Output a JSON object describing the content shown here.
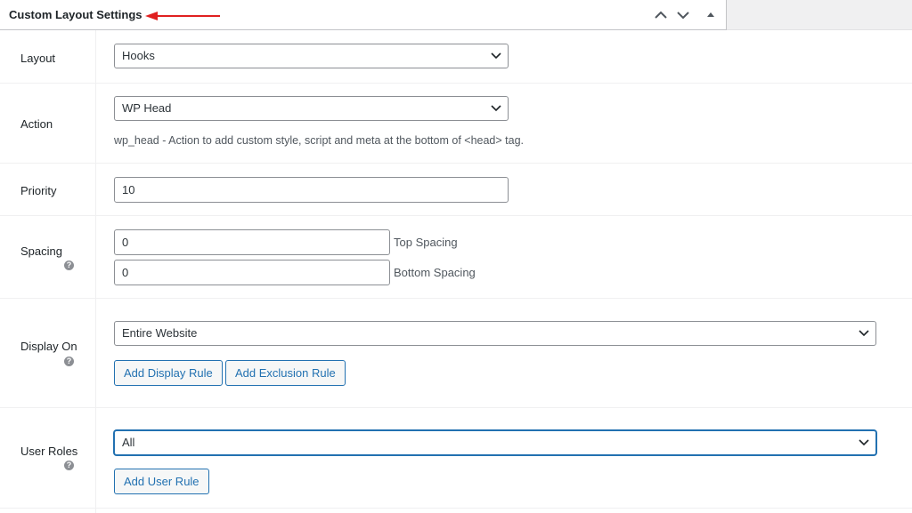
{
  "panel": {
    "title": "Custom Layout Settings",
    "controls": [
      "chevron-up-icon",
      "chevron-down-icon",
      "triangle-up-icon"
    ],
    "arrow_color": "#e02020"
  },
  "fields": {
    "layout": {
      "label": "Layout",
      "value": "Hooks"
    },
    "action": {
      "label": "Action",
      "value": "WP Head",
      "description": "wp_head - Action to add custom style, script and meta at the bottom of <head> tag."
    },
    "priority": {
      "label": "Priority",
      "value": "10"
    },
    "spacing": {
      "label": "Spacing",
      "top_value": "0",
      "top_label": "Top Spacing",
      "bottom_value": "0",
      "bottom_label": "Bottom Spacing"
    },
    "display_on": {
      "label": "Display On",
      "value": "Entire Website",
      "add_display_rule": "Add Display Rule",
      "add_exclusion_rule": "Add Exclusion Rule"
    },
    "user_roles": {
      "label": "User Roles",
      "value": "All",
      "add_user_rule": "Add User Rule"
    }
  },
  "colors": {
    "accent": "#2271b1",
    "border": "#8c8f94"
  }
}
